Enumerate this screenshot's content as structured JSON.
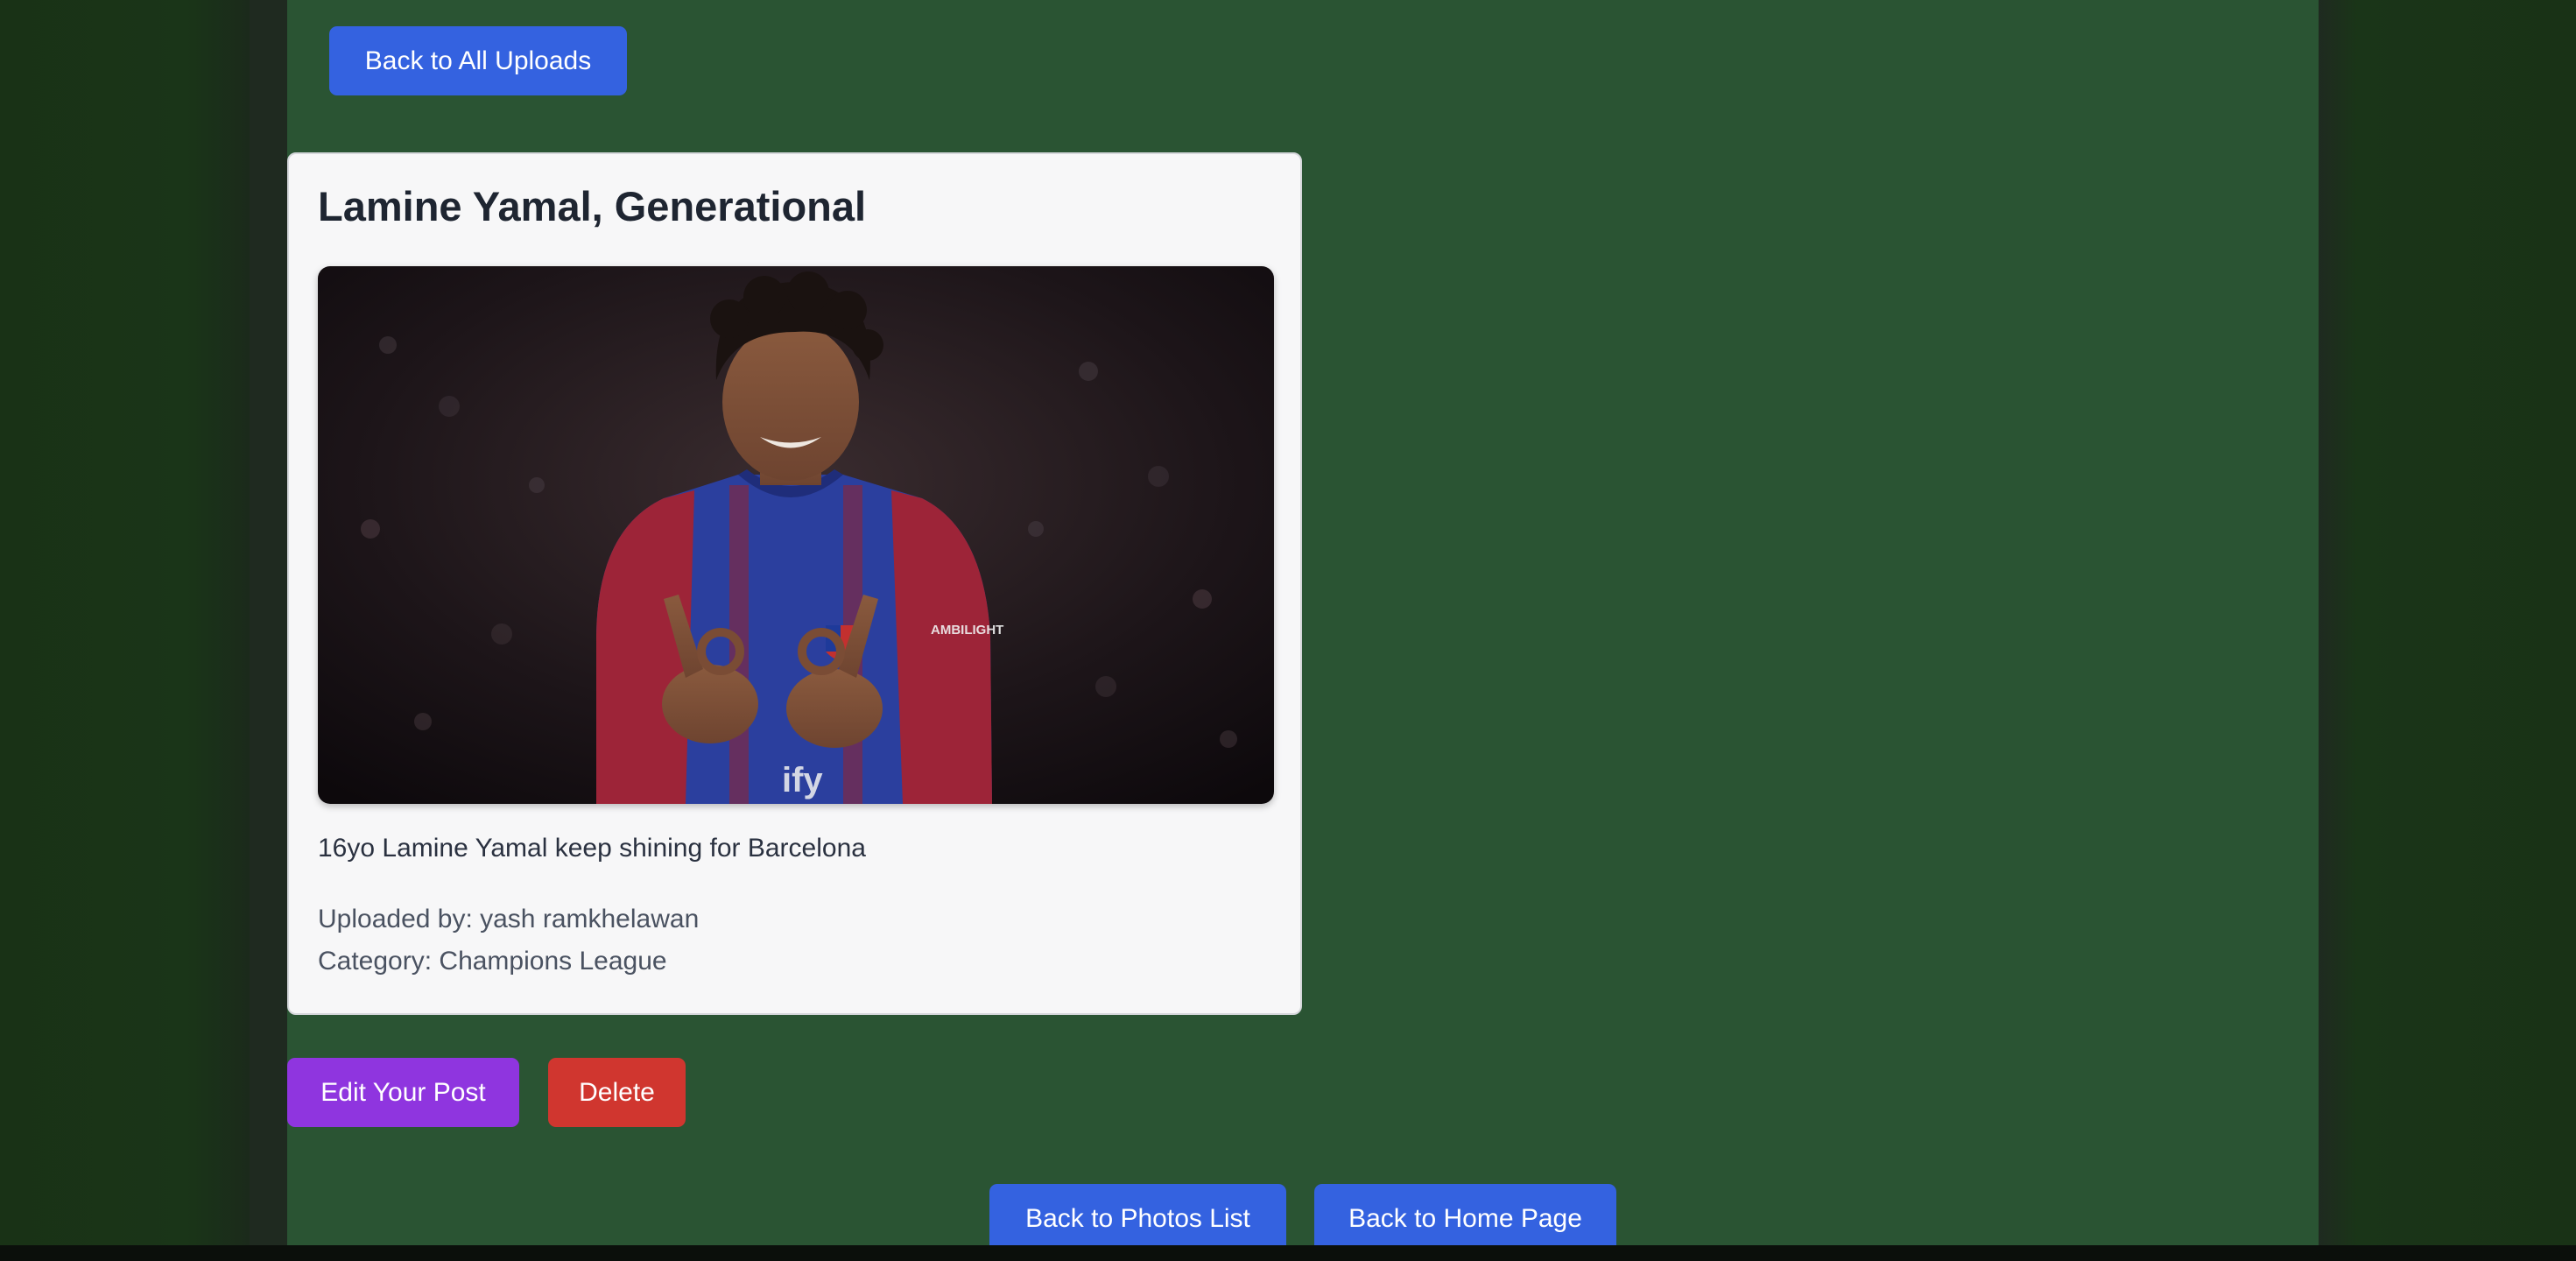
{
  "nav": {
    "back_all_uploads": "Back to All Uploads",
    "back_photos_list": "Back to Photos List",
    "back_home": "Back to Home Page"
  },
  "post": {
    "title": "Lamine Yamal, Generational",
    "image_alt": "Lamine Yamal celebrating in a Barcelona shirt",
    "description": "16yo Lamine Yamal keep shining for Barcelona",
    "uploaded_by": "Uploaded by: yash ramkhelawan",
    "category": "Category: Champions League"
  },
  "actions": {
    "edit": "Edit Your Post",
    "delete": "Delete"
  },
  "colors": {
    "page_background": "#2a5433",
    "primary_button": "#3462e0",
    "edit_button": "#8f35df",
    "delete_button": "#d0362f",
    "card_background": "#f7f7f8"
  }
}
